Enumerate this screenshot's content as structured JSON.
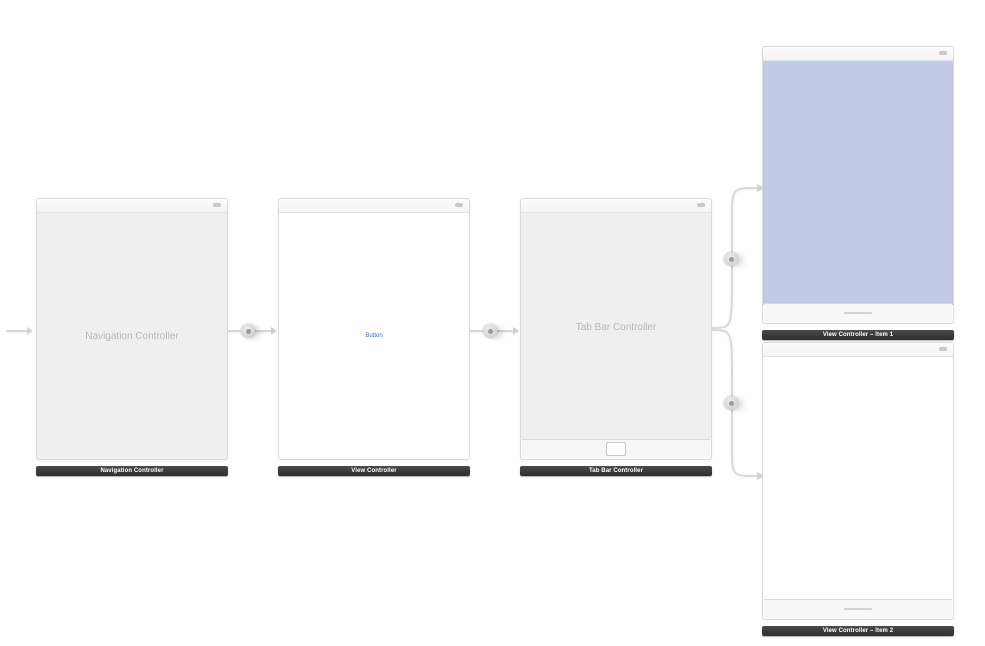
{
  "scenes": {
    "nav": {
      "floor": "Navigation Controller",
      "placeholder": "Navigation Controller"
    },
    "vc": {
      "floor": "View Controller",
      "button": "Button"
    },
    "tabbar": {
      "floor": "Tab Bar Controller",
      "placeholder": "Tab Bar Controller"
    },
    "item1": {
      "floor": "View Controller – Item 1"
    },
    "item2": {
      "floor": "View Controller – Item 2"
    }
  }
}
